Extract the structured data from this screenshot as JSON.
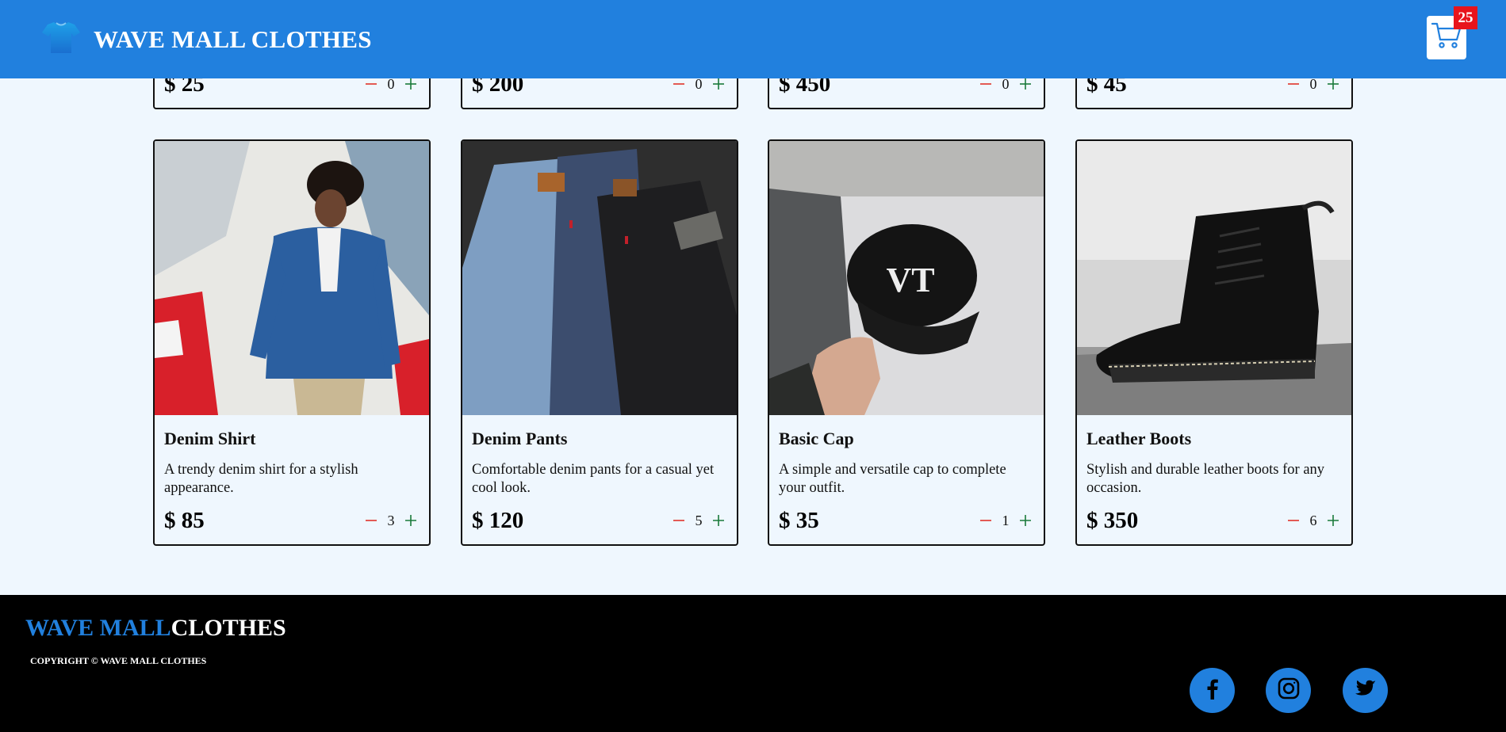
{
  "header": {
    "title": "WAVE MALL CLOTHES",
    "cart_count": "25"
  },
  "colors": {
    "brand_blue": "#2180de",
    "badge_red": "#e8141c",
    "minus_red": "#e0322a",
    "plus_green": "#1a7a3a",
    "page_bg": "#eff7fe"
  },
  "top_products": [
    {
      "price": "$ 25",
      "qty": "0"
    },
    {
      "price": "$ 200",
      "qty": "0"
    },
    {
      "price": "$ 450",
      "qty": "0"
    },
    {
      "price": "$ 45",
      "qty": "0"
    }
  ],
  "products": [
    {
      "name": "Denim Shirt",
      "description": "A trendy denim shirt for a stylish appearance.",
      "price": "$ 85",
      "qty": "3",
      "image": "denim-shirt-photo"
    },
    {
      "name": "Denim Pants",
      "description": "Comfortable denim pants for a casual yet cool look.",
      "price": "$ 120",
      "qty": "5",
      "image": "denim-pants-photo"
    },
    {
      "name": "Basic Cap",
      "description": "A simple and versatile cap to complete your outfit.",
      "price": "$ 35",
      "qty": "1",
      "image": "basic-cap-photo"
    },
    {
      "name": "Leather Boots",
      "description": "Stylish and durable leather boots for any occasion.",
      "price": "$ 350",
      "qty": "6",
      "image": "leather-boots-photo"
    }
  ],
  "footer": {
    "brand_part1": "WAVE MALL",
    "brand_part2": "CLOTHES",
    "copyright": "COPYRIGHT © WAVE MALL CLOTHES",
    "social": [
      "facebook-icon",
      "instagram-icon",
      "twitter-icon"
    ]
  }
}
